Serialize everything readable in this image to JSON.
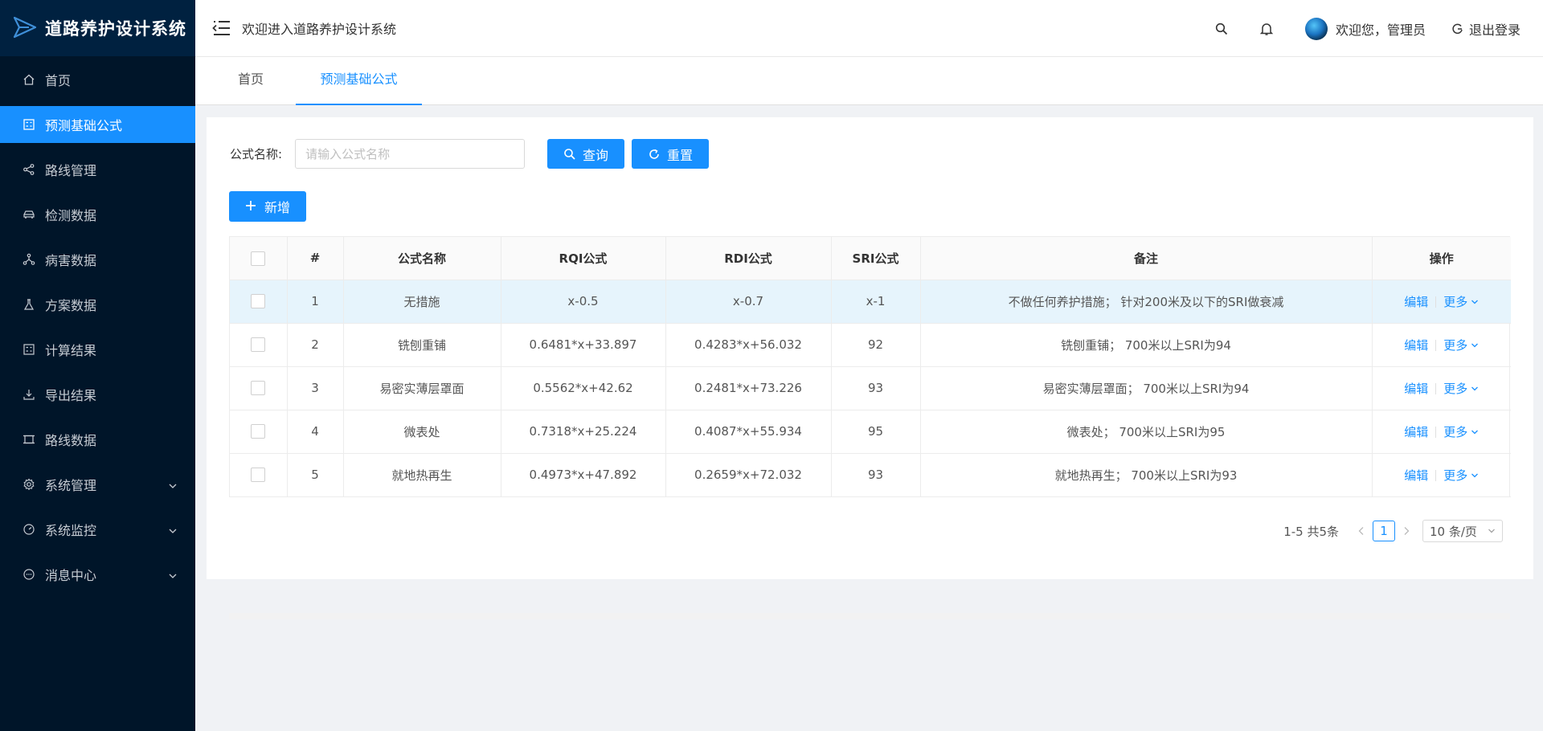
{
  "app": {
    "brand": "道路养护设计系统",
    "welcome": "欢迎进入道路养护设计系统"
  },
  "header": {
    "user_greeting": "欢迎您，管理员",
    "logout": "退出登录"
  },
  "sidebar": {
    "items": [
      {
        "label": "首页",
        "icon": "home-icon"
      },
      {
        "label": "预测基础公式",
        "icon": "formula-icon",
        "active": true
      },
      {
        "label": "路线管理",
        "icon": "share-icon"
      },
      {
        "label": "检测数据",
        "icon": "car-icon"
      },
      {
        "label": "病害数据",
        "icon": "cluster-icon"
      },
      {
        "label": "方案数据",
        "icon": "experiment-icon"
      },
      {
        "label": "计算结果",
        "icon": "calculator-icon"
      },
      {
        "label": "导出结果",
        "icon": "download-icon"
      },
      {
        "label": "路线数据",
        "icon": "road-icon"
      },
      {
        "label": "系统管理",
        "icon": "gear-icon",
        "expandable": true
      },
      {
        "label": "系统监控",
        "icon": "dashboard-icon",
        "expandable": true
      },
      {
        "label": "消息中心",
        "icon": "message-icon",
        "expandable": true
      }
    ]
  },
  "tabs": [
    {
      "label": "首页"
    },
    {
      "label": "预测基础公式",
      "active": true
    }
  ],
  "search": {
    "label": "公式名称:",
    "placeholder": "请输入公式名称",
    "value": "",
    "query_label": "查询",
    "reset_label": "重置"
  },
  "toolbar": {
    "add_label": "新增"
  },
  "table": {
    "columns": [
      "#",
      "公式名称",
      "RQI公式",
      "RDI公式",
      "SRI公式",
      "备注",
      "操作"
    ],
    "rows": [
      {
        "no": "1",
        "name": "无措施",
        "rqi": "x-0.5",
        "rdi": "x-0.7",
        "sri": "x-1",
        "note": "不做任何养护措施； 针对200米及以下的SRI做衰减"
      },
      {
        "no": "2",
        "name": "铣刨重铺",
        "rqi": "0.6481*x+33.897",
        "rdi": "0.4283*x+56.032",
        "sri": "92",
        "note": "铣刨重铺； 700米以上SRI为94"
      },
      {
        "no": "3",
        "name": "易密实薄层罩面",
        "rqi": "0.5562*x+42.62",
        "rdi": "0.2481*x+73.226",
        "sri": "93",
        "note": "易密实薄层罩面； 700米以上SRI为94"
      },
      {
        "no": "4",
        "name": "微表处",
        "rqi": "0.7318*x+25.224",
        "rdi": "0.4087*x+55.934",
        "sri": "95",
        "note": "微表处； 700米以上SRI为95"
      },
      {
        "no": "5",
        "name": "就地热再生",
        "rqi": "0.4973*x+47.892",
        "rdi": "0.2659*x+72.032",
        "sri": "93",
        "note": "就地热再生； 700米以上SRI为93"
      }
    ],
    "edit_label": "编辑",
    "more_label": "更多"
  },
  "pagination": {
    "total_text": "1-5 共5条",
    "current_page": "1",
    "page_size": "10 条/页"
  },
  "colors": {
    "primary": "#1890ff",
    "sidebar_bg": "#001529",
    "highlight_row": "#e6f4fc"
  }
}
